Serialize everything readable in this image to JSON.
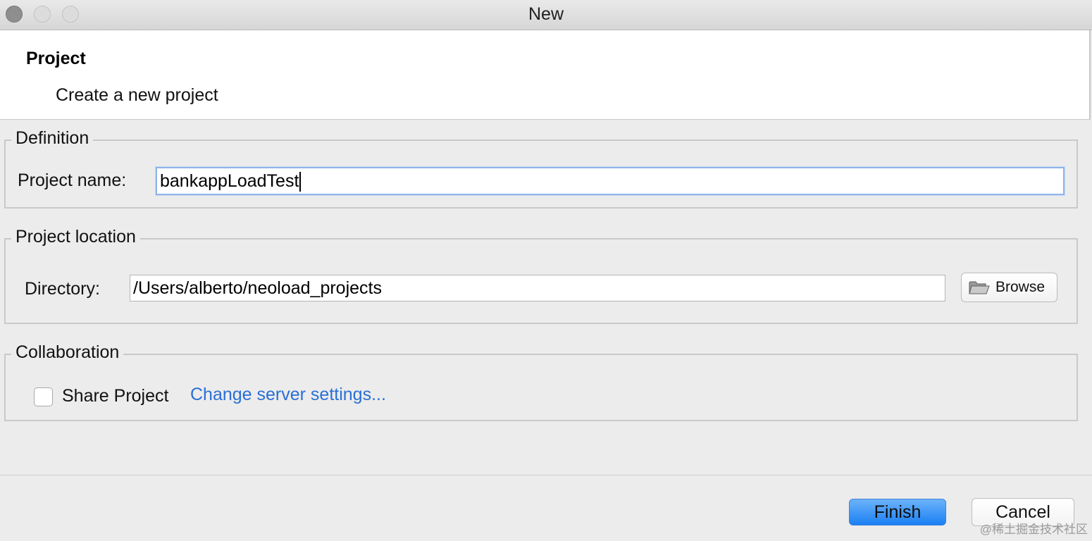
{
  "window": {
    "title": "New"
  },
  "banner": {
    "title": "Project",
    "description": "Create a new project"
  },
  "definition": {
    "legend": "Definition",
    "project_name_label": "Project name:",
    "project_name_value": "bankappLoadTest"
  },
  "location": {
    "legend": "Project location",
    "directory_label": "Directory:",
    "directory_value": "/Users/alberto/neoload_projects",
    "browse_label": "Browse"
  },
  "collaboration": {
    "legend": "Collaboration",
    "share_label": "Share Project",
    "share_checked": false,
    "server_link": "Change server settings..."
  },
  "footer": {
    "finish_label": "Finish",
    "cancel_label": "Cancel"
  },
  "watermark": "@稀土掘金技术社区",
  "colors": {
    "accent": "#1a7ff3",
    "link": "#2a6fd6"
  }
}
